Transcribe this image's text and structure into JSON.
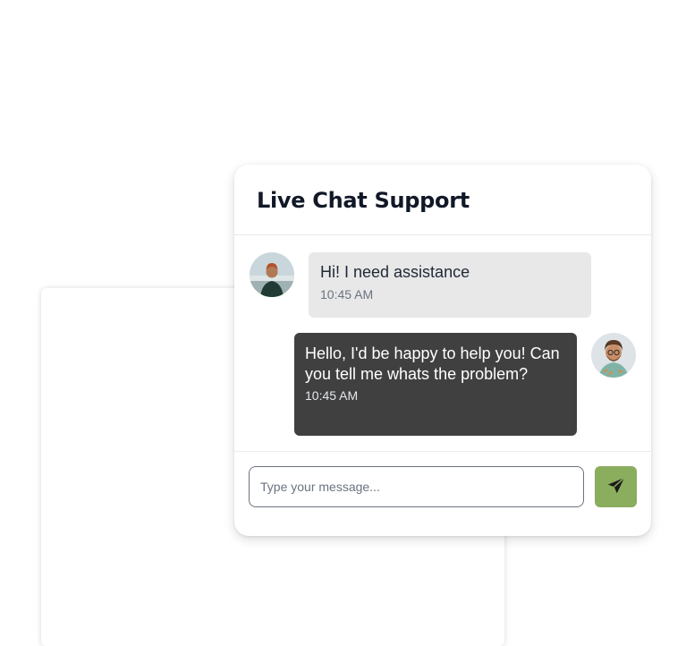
{
  "chat": {
    "title": "Live Chat Support",
    "messages": [
      {
        "sender": "agent",
        "text": "Hi! I need assistance",
        "time": "10:45 AM"
      },
      {
        "sender": "user",
        "text": "Hello, I'd be happy to help you! Can you tell me whats the problem?",
        "time": "10:45 AM"
      }
    ],
    "input": {
      "placeholder": "Type your message...",
      "value": ""
    },
    "send_icon": "paper-plane-icon"
  },
  "colors": {
    "incoming_bubble": "#e8e8e8",
    "outgoing_bubble": "#404040",
    "send_button": "#8aad5e",
    "title": "#111827"
  }
}
